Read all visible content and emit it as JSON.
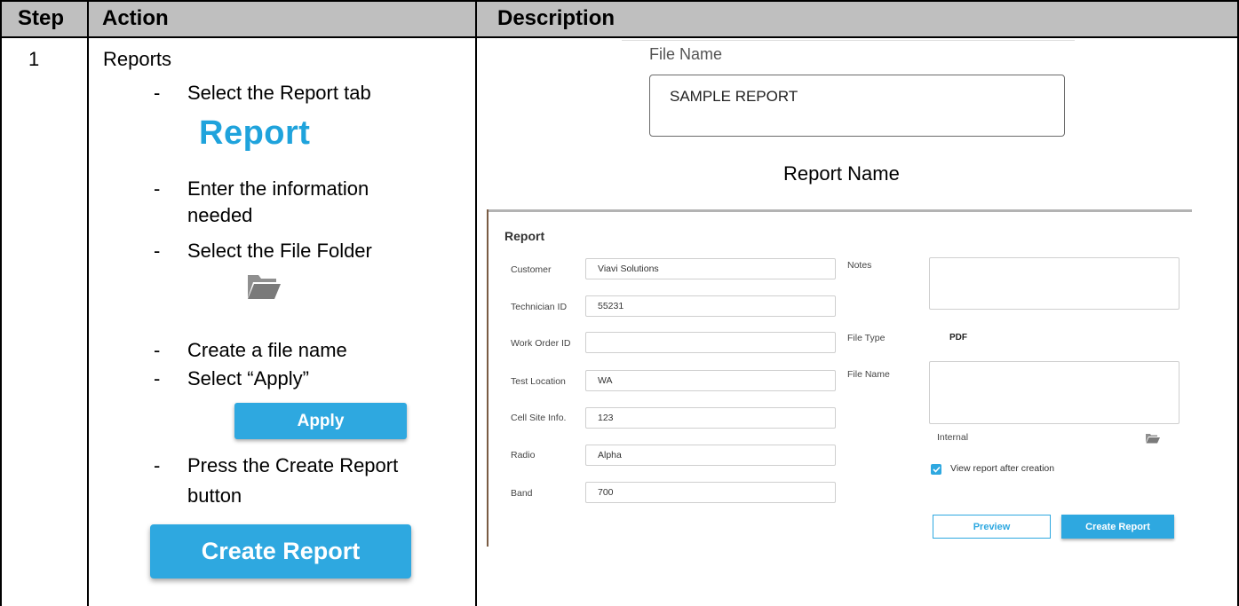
{
  "table": {
    "headers": [
      "Step",
      "Action",
      "Description"
    ],
    "step": "1"
  },
  "action": {
    "title": "Reports",
    "steps": [
      "Select the Report tab",
      "Enter the information",
      "needed",
      "Select the File Folder",
      "Create a file name",
      "Select “Apply”",
      "Press the Create Report",
      "button"
    ],
    "dash": "-",
    "report_tab_label": "Report",
    "folder_icon": "folder-open-icon",
    "apply_label": "Apply",
    "create_report_label": "Create Report"
  },
  "description": {
    "file_name_label": "File Name",
    "file_name_value": "SAMPLE REPORT",
    "caption": "Report Name",
    "form": {
      "title": "Report",
      "fields": [
        {
          "label": "Customer",
          "value": "Viavi Solutions"
        },
        {
          "label": "Technician ID",
          "value": "55231"
        },
        {
          "label": "Work Order ID",
          "value": ""
        },
        {
          "label": "Test Location",
          "value": "WA"
        },
        {
          "label": "Cell Site Info.",
          "value": "123"
        },
        {
          "label": "Radio",
          "value": "Alpha"
        },
        {
          "label": "Band",
          "value": "700"
        }
      ],
      "notes_label": "Notes",
      "file_type_label": "File Type",
      "file_type_value": "PDF",
      "file_name_label": "File Name",
      "location": "Internal",
      "view_after_label": "View report after creation",
      "preview_label": "Preview",
      "create_report_label": "Create Report"
    }
  },
  "colors": {
    "accent": "#2ea8e0",
    "report_text": "#1fa3dc",
    "header_bg": "#bfbfbf"
  }
}
